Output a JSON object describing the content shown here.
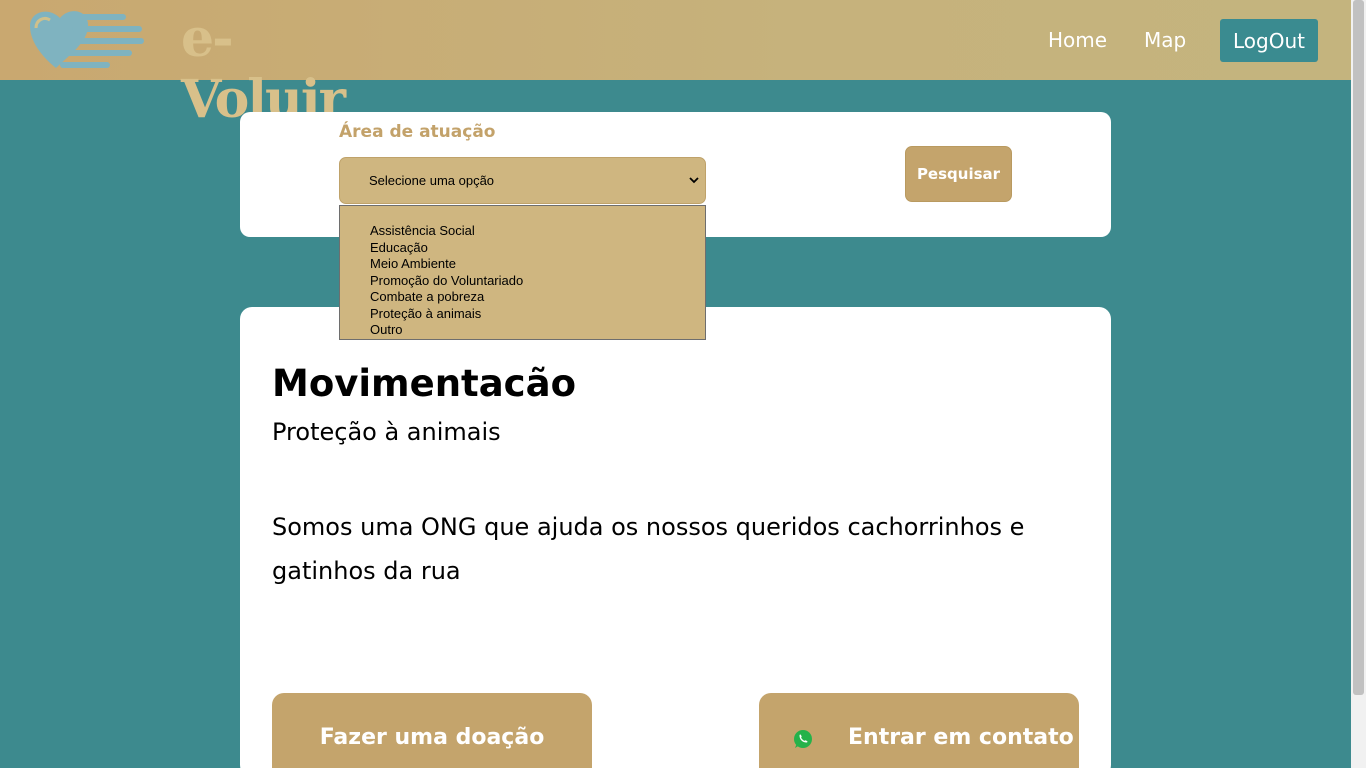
{
  "header": {
    "logo_text": "e-Voluir",
    "nav": {
      "home": "Home",
      "map": "Map",
      "logout": "LogOut"
    }
  },
  "search": {
    "area_label": "Área de atuação",
    "select_value": "Selecione uma opção",
    "options": [
      "Assistência Social",
      "Educação",
      "Meio Ambiente",
      "Promoção do Voluntariado",
      "Combate a pobreza",
      "Proteção à animais",
      "Outro"
    ],
    "search_button": "Pesquisar"
  },
  "organization": {
    "name": "Movimentacão",
    "area": "Proteção à animais",
    "description": "Somos uma ONG que ajuda os nossos queridos cachorrinhos e gatinhos da rua",
    "donate_button": "Fazer uma doação",
    "contact_button": "Entrar em contato"
  },
  "icons": {
    "logo": "heart-hands-logo-icon",
    "select_arrow": "chevron-down-icon",
    "contact": "whatsapp-icon"
  },
  "colors": {
    "background": "#3d8a8e",
    "accent_gold": "#c4a46c",
    "logout_teal": "#3a8b90",
    "logo_blue": "#7fb3c0"
  }
}
